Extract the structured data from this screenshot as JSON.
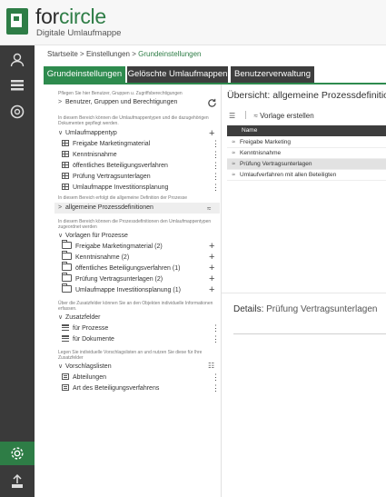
{
  "app": {
    "brand_prefix": "for",
    "brand_suffix": "circle",
    "subtitle": "Digitale Umlaufmappe"
  },
  "breadcrumb": {
    "home": "Startseite",
    "sep1": ">",
    "mid": "Einstellungen",
    "sep2": ">",
    "current": "Grundeinstellungen"
  },
  "tabs": [
    {
      "label": "Grundeinstellungen",
      "active": true
    },
    {
      "label": "Gelöschte Umlaufmappen",
      "active": false
    },
    {
      "label": "Benutzerverwaltung",
      "active": false
    }
  ],
  "left": {
    "hint_users": "Pflegen Sie hier Benutzer, Gruppen u. Zugriffsberechtigungen",
    "users_section": "Benutzer, Gruppen und Berechtigungen",
    "hint_types": "In diesem Bereich können die Umlaufmappentypen und die dazugehörigen Dokumenten gepflegt werden.",
    "types_section": "Umlaufmappentyp",
    "types": [
      "Freigabe Marketingmaterial",
      "Kenntnisnahme",
      "öffentliches Beteiligungsverfahren",
      "Prüfung Vertragsunterlagen",
      "Umlaufmappe Investitionsplanung"
    ],
    "hint_process": "In diesem Bereich erfolgt die allgemeine Definition der Prozesse",
    "process_section": "allgemeine Prozessdefinitionen",
    "hint_templates": "In diesem Bereich können die Prozessdefinitionen den Umlaufmappentypen zugeordnet werden",
    "templates_section": "Vorlagen für Prozesse",
    "templates": [
      "Freigabe Marketingmaterial (2)",
      "Kenntnisnahme (2)",
      "öffentliches Beteiligungsverfahren (1)",
      "Prüfung Vertragsunterlagen (2)",
      "Umlaufmappe Investitionsplanung (1)"
    ],
    "hint_fields": "Über die Zusatzfelder können Sie an den Objekten individuelle Informationen erfassen.",
    "fields_section": "Zusatzfelder",
    "fields": [
      "für Prozesse",
      "für Dokumente"
    ],
    "hint_lists": "Legen Sie individuelle Vorschlagslisten an und nutzen Sie diese für Ihre Zusatzfelder",
    "lists_section": "Vorschlagslisten",
    "lists": [
      "Abteilungen",
      "Art des Beteiligungsverfahrens"
    ]
  },
  "right": {
    "overview_prefix": "Übersicht:",
    "overview_title": "allgemeine Prozessdefinitionen",
    "create_template": "Vorlage erstellen",
    "column_name": "Name",
    "rows": [
      "Freigabe Marketing",
      "Kenntnisnahme",
      "Prüfung Vertragsunterlagen",
      "Umlaufverfahren mit allen Beteiligten"
    ],
    "selected_row": 2,
    "details_prefix": "Details:",
    "details_title": "Prüfung Vertragsunterlagen"
  },
  "colors": {
    "accent": "#2e8b4e",
    "nav_bg": "#3a3a3a",
    "tab_bg": "#3e3e3e"
  }
}
